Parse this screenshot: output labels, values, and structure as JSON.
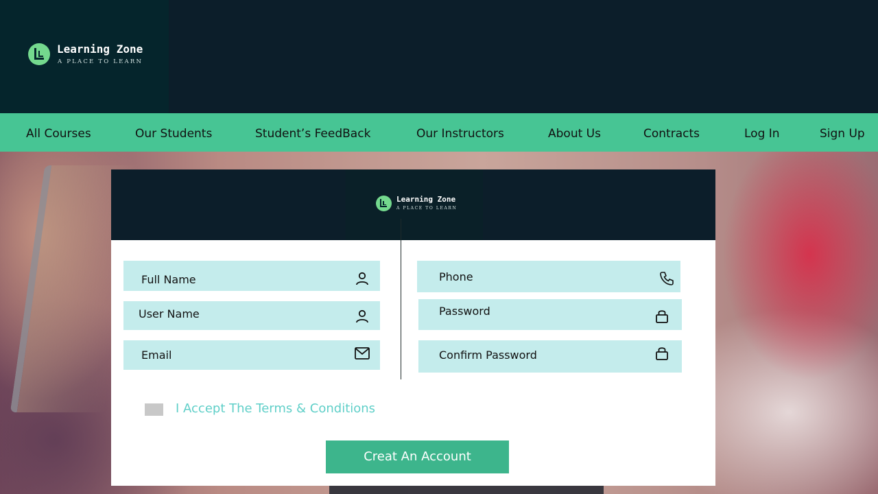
{
  "brand": {
    "name": "Learning Zone",
    "tagline": "A PLACE TO LEARN"
  },
  "nav": {
    "items": [
      {
        "label": "All Courses"
      },
      {
        "label": "Our Students"
      },
      {
        "label": "Student’s FeedBack"
      },
      {
        "label": "Our Instructors"
      },
      {
        "label": "About Us"
      },
      {
        "label": "Contracts"
      },
      {
        "label": "Log In"
      },
      {
        "label": "Sign Up"
      }
    ]
  },
  "form": {
    "fields": {
      "full_name": {
        "label": "Full Name",
        "icon": "user-icon"
      },
      "user_name": {
        "label": "User Name",
        "icon": "user-icon"
      },
      "email": {
        "label": "Email",
        "icon": "mail-icon"
      },
      "phone": {
        "label": "Phone",
        "icon": "phone-icon"
      },
      "password": {
        "label": "Password",
        "icon": "lock-icon"
      },
      "confirm_password": {
        "label": "Confirm Password",
        "icon": "lock-icon"
      }
    },
    "terms_label": "I Accept The Terms & Conditions",
    "submit_label": "Creat An Account"
  },
  "colors": {
    "header_bg": "#0c1e2a",
    "nav_bg": "#47c594",
    "field_bg": "#c4ecec",
    "accent_button": "#3db58c",
    "terms_text": "#5fcfc8",
    "logo_green": "#74d98e"
  }
}
